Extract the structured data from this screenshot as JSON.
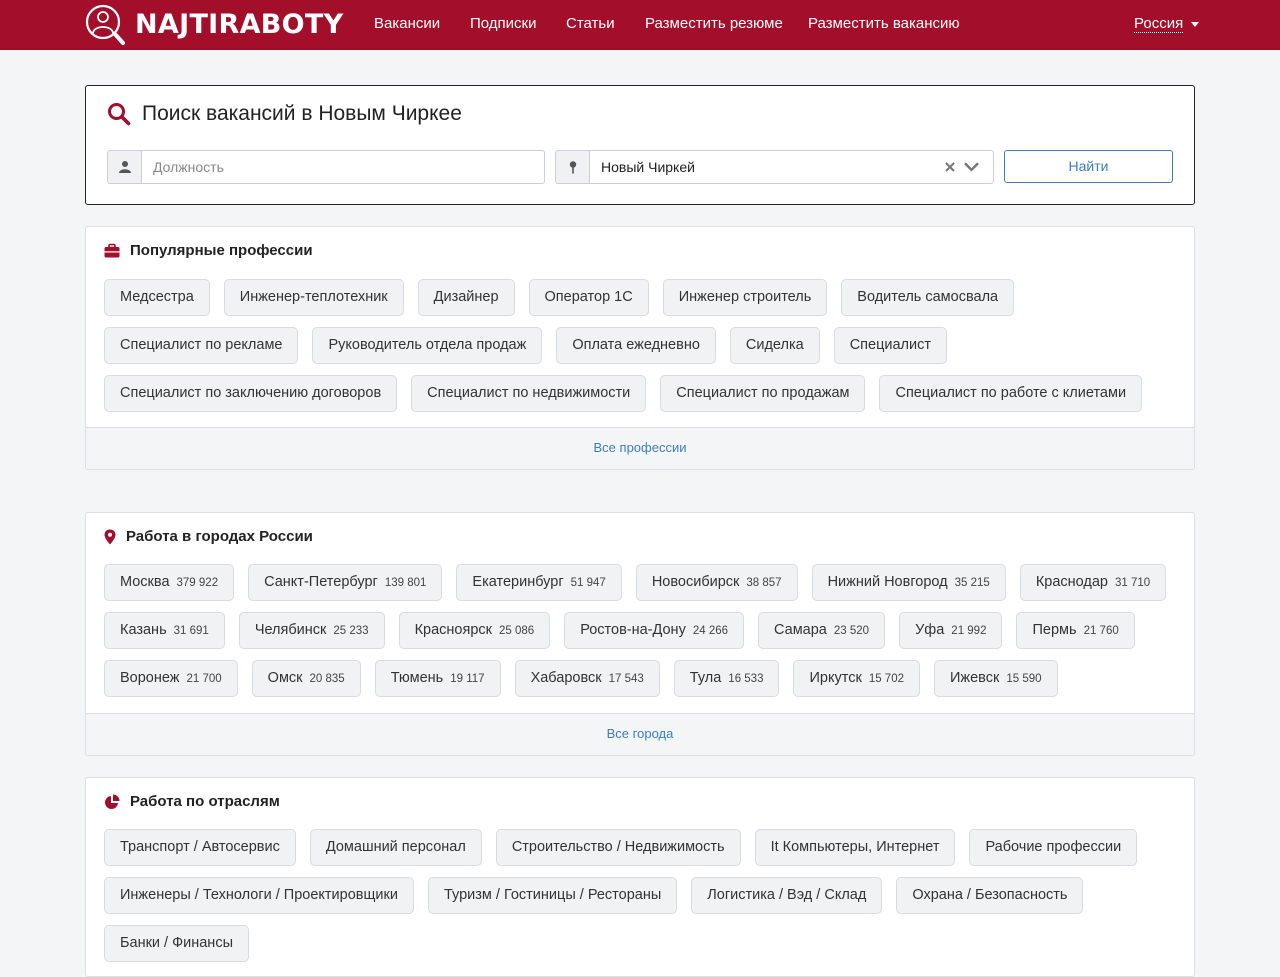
{
  "header": {
    "logo_text": "NAJTIRABOTY",
    "nav": [
      "Вакансии",
      "Подписки",
      "Статьи",
      "Разместить резюме",
      "Разместить вакансию"
    ],
    "country": "Россия",
    "brand_color": "#a30f2b"
  },
  "search": {
    "title": "Поиск вакансий в Новым Чиркее",
    "position_placeholder": "Должность",
    "location_value": "Новый Чиркей",
    "find_button": "Найти"
  },
  "professions": {
    "title": "Популярные профессии",
    "icon": "briefcase-icon",
    "items": [
      "Медсестра",
      "Инженер-теплотехник",
      "Дизайнер",
      "Оператор 1С",
      "Инженер строитель",
      "Водитель самосвала",
      "Специалист по рекламе",
      "Руководитель отдела продаж",
      "Оплата ежедневно",
      "Сиделка",
      "Специалист",
      "Специалист по заключению договоров",
      "Специалист по недвижимости",
      "Специалист по продажам",
      "Специалист по работе с клиетами"
    ],
    "footer_link": "Все профессии"
  },
  "cities": {
    "title": "Работа в городах России",
    "icon": "map-marker-icon",
    "items": [
      {
        "name": "Москва",
        "count": "379 922"
      },
      {
        "name": "Санкт-Петербург",
        "count": "139 801"
      },
      {
        "name": "Екатеринбург",
        "count": "51 947"
      },
      {
        "name": "Новосибирск",
        "count": "38 857"
      },
      {
        "name": "Нижний Новгород",
        "count": "35 215"
      },
      {
        "name": "Краснодар",
        "count": "31 710"
      },
      {
        "name": "Казань",
        "count": "31 691"
      },
      {
        "name": "Челябинск",
        "count": "25 233"
      },
      {
        "name": "Красноярск",
        "count": "25 086"
      },
      {
        "name": "Ростов-на-Дону",
        "count": "24 266"
      },
      {
        "name": "Самара",
        "count": "23 520"
      },
      {
        "name": "Уфа",
        "count": "21 992"
      },
      {
        "name": "Пермь",
        "count": "21 760"
      },
      {
        "name": "Воронеж",
        "count": "21 700"
      },
      {
        "name": "Омск",
        "count": "20 835"
      },
      {
        "name": "Тюмень",
        "count": "19 117"
      },
      {
        "name": "Хабаровск",
        "count": "17 543"
      },
      {
        "name": "Тула",
        "count": "16 533"
      },
      {
        "name": "Иркутск",
        "count": "15 702"
      },
      {
        "name": "Ижевск",
        "count": "15 590"
      }
    ],
    "footer_link": "Все города"
  },
  "industries": {
    "title": "Работа по отраслям",
    "icon": "pie-chart-icon",
    "items": [
      "Транспорт / Автосервис",
      "Домашний персонал",
      "Строительство / Недвижимость",
      "It Компьютеры, Интернет",
      "Рабочие профессии",
      "Инженеры / Технологи / Проектировщики",
      "Туризм / Гостиницы / Рестораны",
      "Логистика / Вэд / Склад",
      "Охрана / Безопасность",
      "Банки / Финансы"
    ]
  }
}
